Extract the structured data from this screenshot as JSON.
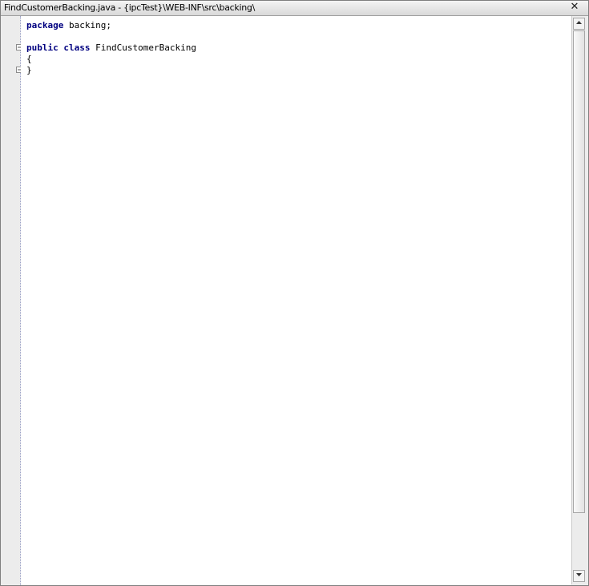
{
  "window": {
    "title": "FindCustomerBacking.java - {ipcTest}\\WEB-INF\\src\\backing\\",
    "close_icon": "close-icon"
  },
  "editor": {
    "lines": [
      {
        "keyword": "package",
        "rest": " backing;"
      },
      {
        "keyword": "",
        "rest": ""
      },
      {
        "keyword": "public class",
        "rest": " FindCustomerBacking"
      },
      {
        "keyword": "",
        "rest": "{"
      },
      {
        "keyword": "",
        "rest": "}"
      }
    ]
  },
  "scrollbar": {
    "up_icon": "scroll-up-arrow-icon",
    "down_icon": "scroll-down-arrow-icon"
  }
}
